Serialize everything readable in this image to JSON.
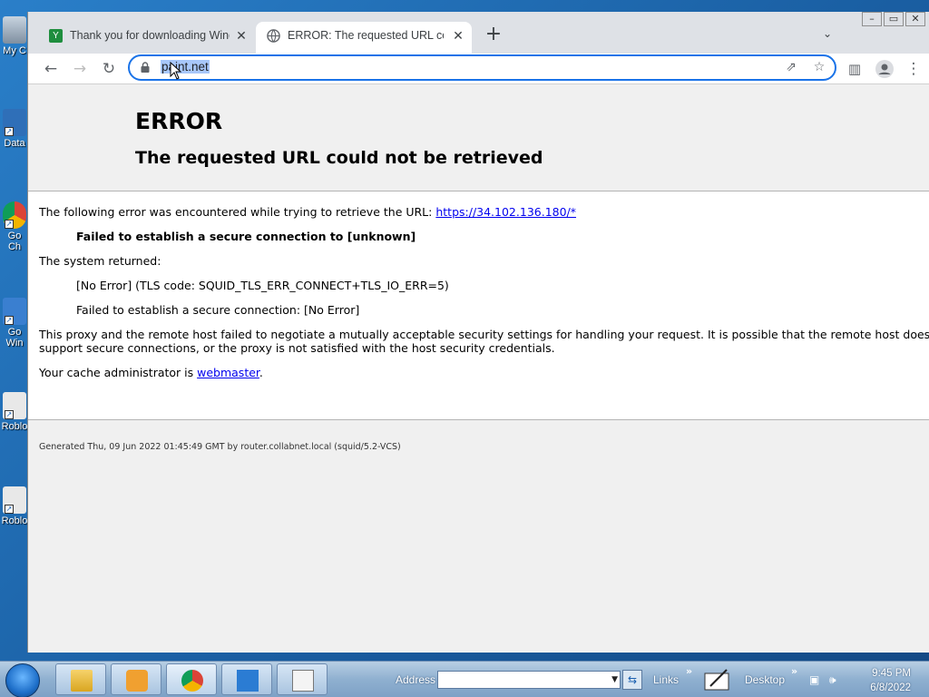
{
  "desktop": {
    "icons": [
      {
        "label": "My C",
        "icon": "computer-icon"
      },
      {
        "label": "Data",
        "icon": "app-icon"
      },
      {
        "label": "Go",
        "icon": "chrome-icon"
      },
      {
        "label": "Ch",
        "icon": "chrome-icon"
      },
      {
        "label": "Go",
        "icon": "app-icon"
      },
      {
        "label": "Win",
        "icon": "app-icon"
      },
      {
        "label": "Roblo",
        "icon": "roblox-icon"
      },
      {
        "label": "Roblo",
        "icon": "roblox-icon"
      }
    ]
  },
  "browser": {
    "tabs": [
      {
        "title": "Thank you for downloading Wind",
        "favicon": "download-favicon",
        "active": false
      },
      {
        "title": "ERROR: The requested URL could",
        "favicon": "globe-icon",
        "active": true
      }
    ],
    "new_tab": "+",
    "address": "paint.net"
  },
  "page": {
    "title": "ERROR",
    "subtitle": "The requested URL could not be retrieved",
    "line1_text": "The following error was encountered while trying to retrieve the URL: ",
    "line1_link": "https://34.102.136.180/*",
    "line2": "Failed to establish a secure connection to [unknown]",
    "line3": "The system returned:",
    "line4": "[No Error] (TLS code: SQUID_TLS_ERR_CONNECT+TLS_IO_ERR=5)",
    "line5": "Failed to establish a secure connection: [No Error]",
    "line6a": "This proxy and the remote host failed to negotiate a mutually acceptable security settings for handling your request. It is possible that the remote host does not",
    "line6b": "support secure connections, or the proxy is not satisfied with the host security credentials.",
    "line7_text": "Your cache administrator is ",
    "line7_link": "webmaster",
    "line7_end": ".",
    "footer": "Generated Thu, 09 Jun 2022 01:45:49 GMT by router.collabnet.local (squid/5.2-VCS)"
  },
  "taskbar": {
    "address_label": "Address",
    "address_value": "",
    "links_label": "Links",
    "desktop_label": "Desktop",
    "time": "9:45 PM",
    "date": "6/8/2022"
  }
}
